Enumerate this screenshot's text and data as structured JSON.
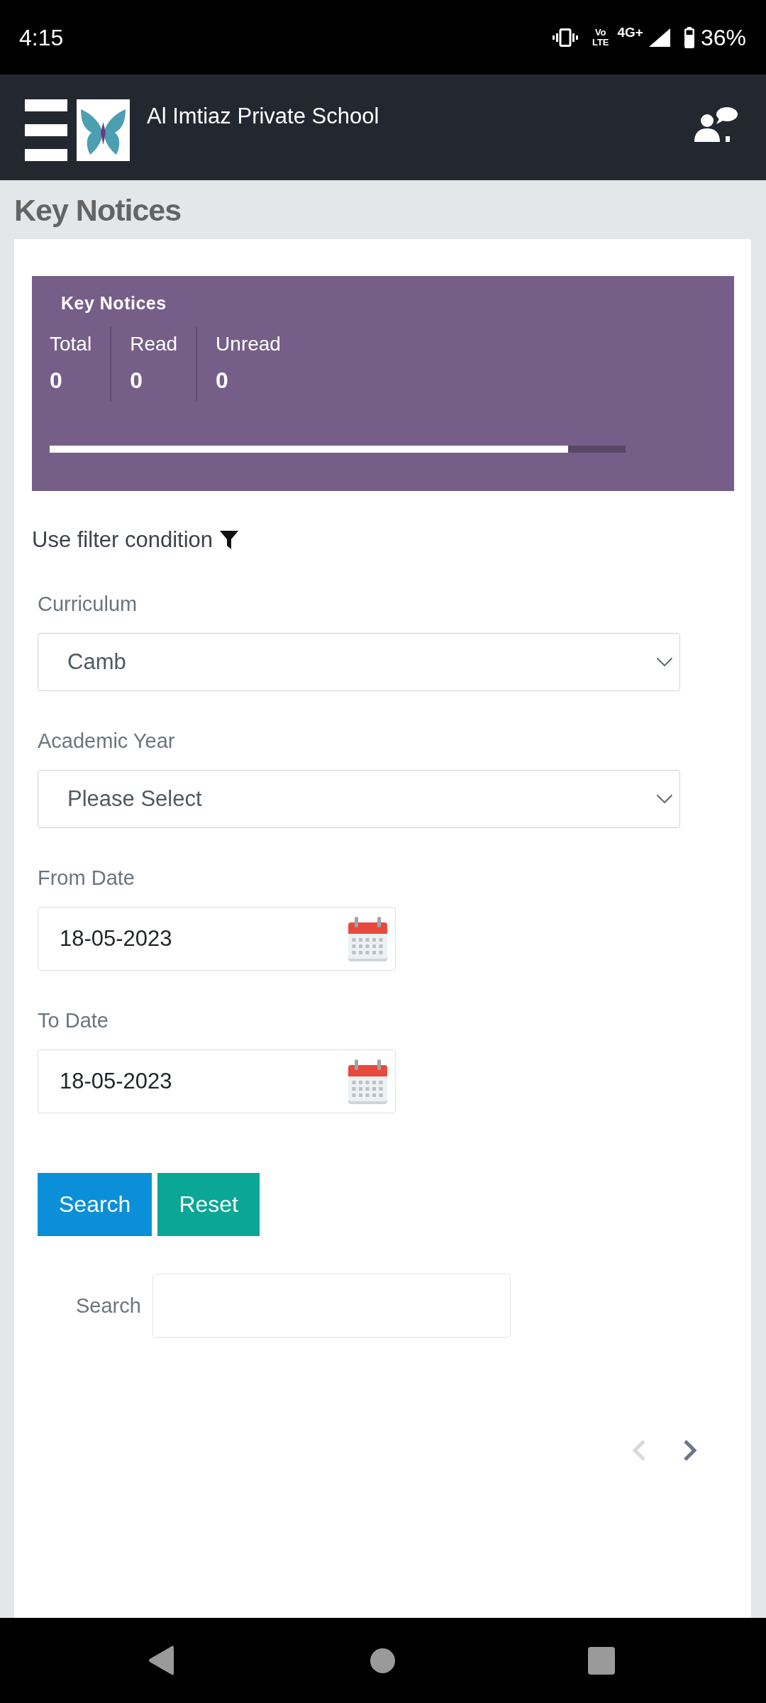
{
  "status_bar": {
    "time": "4:15",
    "volte_lines": [
      "Vo",
      "LTE"
    ],
    "network": "4G+",
    "battery": "36%"
  },
  "header": {
    "title": "Al Imtiaz Private School"
  },
  "page_title": "Key Notices",
  "summary": {
    "title": "Key Notices",
    "stats": [
      {
        "label": "Total",
        "value": "0"
      },
      {
        "label": "Read",
        "value": "0"
      },
      {
        "label": "Unread",
        "value": "0"
      }
    ],
    "progress": {
      "level": 0.9
    }
  },
  "filter": {
    "heading": "Use filter condition",
    "fields": [
      {
        "kind": "select",
        "label": "Curriculum",
        "value": "Camb"
      },
      {
        "kind": "select",
        "label": "Academic Year",
        "value": "Please Select"
      },
      {
        "kind": "date",
        "label": "From Date",
        "value": "18-05-2023"
      },
      {
        "kind": "date",
        "label": "To Date",
        "value": "18-05-2023"
      }
    ],
    "buttons": [
      {
        "kind": "primary",
        "label": "Search"
      },
      {
        "kind": "secondary",
        "label": "Reset"
      }
    ]
  },
  "search": {
    "label": "Search"
  },
  "pagination": [
    {
      "kind": "previous",
      "disabled": true
    },
    {
      "kind": "next",
      "disabled": false
    }
  ]
}
